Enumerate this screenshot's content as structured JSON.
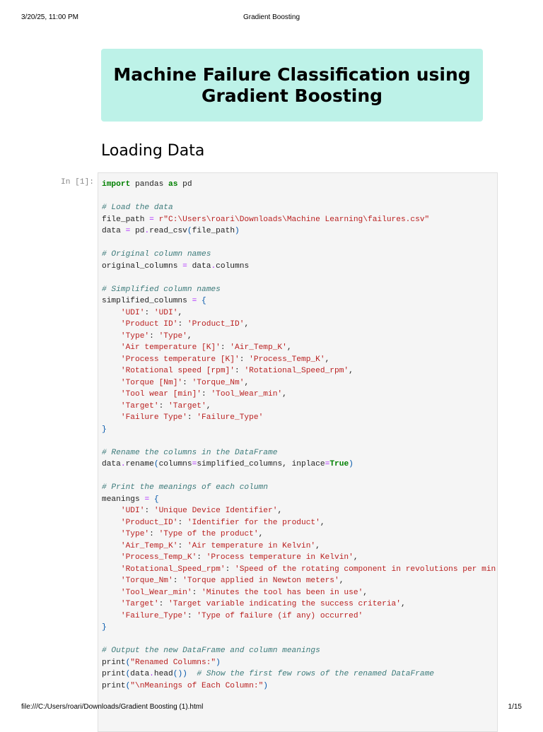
{
  "print_header": {
    "datetime": "3/20/25, 11:00 PM",
    "title": "Gradient Boosting"
  },
  "print_footer": {
    "path": "file:///C:/Users/roari/Downloads/Gradient Boosting (1).html",
    "page": "1/15"
  },
  "banner": {
    "line1": "Machine Failure Classification using",
    "line2": "Gradient Boosting"
  },
  "section_heading": "Loading Data",
  "cell": {
    "prompt": "In [1]:",
    "lines": [
      "import pandas as pd",
      "",
      "# Load the data",
      "file_path = r\"C:\\Users\\roari\\Downloads\\Machine Learning\\failures.csv\"",
      "data = pd.read_csv(file_path)",
      "",
      "# Original column names",
      "original_columns = data.columns",
      "",
      "# Simplified column names",
      "simplified_columns = {",
      "    'UDI': 'UDI',",
      "    'Product ID': 'Product_ID',",
      "    'Type': 'Type',",
      "    'Air temperature [K]': 'Air_Temp_K',",
      "    'Process temperature [K]': 'Process_Temp_K',",
      "    'Rotational speed [rpm]': 'Rotational_Speed_rpm',",
      "    'Torque [Nm]': 'Torque_Nm',",
      "    'Tool wear [min]': 'Tool_Wear_min',",
      "    'Target': 'Target',",
      "    'Failure Type': 'Failure_Type'",
      "}",
      "",
      "# Rename the columns in the DataFrame",
      "data.rename(columns=simplified_columns, inplace=True)",
      "",
      "# Print the meanings of each column",
      "meanings = {",
      "    'UDI': 'Unique Device Identifier',",
      "    'Product_ID': 'Identifier for the product',",
      "    'Type': 'Type of the product',",
      "    'Air_Temp_K': 'Air temperature in Kelvin',",
      "    'Process_Temp_K': 'Process temperature in Kelvin',",
      "    'Rotational_Speed_rpm': 'Speed of the rotating component in revolutions per min",
      "    'Torque_Nm': 'Torque applied in Newton meters',",
      "    'Tool_Wear_min': 'Minutes the tool has been in use',",
      "    'Target': 'Target variable indicating the success criteria',",
      "    'Failure_Type': 'Type of failure (if any) occurred'",
      "}",
      "",
      "# Output the new DataFrame and column meanings",
      "print(\"Renamed Columns:\")",
      "print(data.head())  # Show the first few rows of the renamed DataFrame",
      "print(\"\\nMeanings of Each Column:\")"
    ]
  }
}
